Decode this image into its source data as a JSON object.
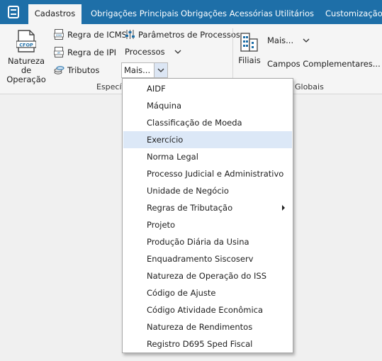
{
  "tabs": [
    {
      "label": "Cadastros",
      "active": true
    },
    {
      "label": "Obrigações Principais",
      "active": false
    },
    {
      "label": "Obrigações Acessórias",
      "active": false
    },
    {
      "label": "Utilitários",
      "active": false
    },
    {
      "label": "Customização",
      "active": false
    }
  ],
  "ribbon": {
    "natureza_label": "Natureza de Operação",
    "natureza_line1": "Natureza de",
    "natureza_line2": "Operação",
    "cfop_badge": "CFOP",
    "regra_icms": "Regra de ICMS",
    "regra_ipi": "Regra de IPI",
    "tributos": "Tributos",
    "parametros": "Parâmetros de Processos",
    "processos": "Processos",
    "mais_combo": "Mais...",
    "group_especificos": "Específ",
    "filiais": "Filiais",
    "mais2": "Mais...",
    "campos": "Campos Complementares...",
    "group_globais": "Globais"
  },
  "dropdown": {
    "items": [
      {
        "label": "AIDF"
      },
      {
        "label": "Máquina"
      },
      {
        "label": "Classificação de Moeda"
      },
      {
        "label": "Exercício",
        "highlighted": true
      },
      {
        "label": "Norma Legal"
      },
      {
        "label": "Processo Judicial e Administrativo"
      },
      {
        "label": "Unidade de Negócio"
      },
      {
        "label": "Regras de Tributação",
        "has_submenu": true
      },
      {
        "label": "Projeto"
      },
      {
        "label": "Produção Diária da Usina"
      },
      {
        "label": "Enquadramento Siscoserv"
      },
      {
        "label": "Natureza de Operação do ISS"
      },
      {
        "label": "Código de Ajuste"
      },
      {
        "label": "Código Atividade Econômica"
      },
      {
        "label": "Natureza de Rendimentos"
      },
      {
        "label": "Registro D695 Sped Fiscal"
      }
    ]
  },
  "colors": {
    "tabbar": "#1e6fa8",
    "menu_highlight": "#dce8f7",
    "combo_arrow_bg": "#dce6f4"
  }
}
